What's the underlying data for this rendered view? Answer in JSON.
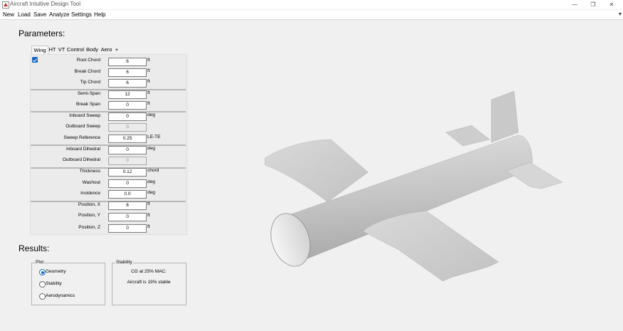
{
  "window": {
    "title": "Aircraft Intuitive Design Tool"
  },
  "menu": [
    "New",
    "Load",
    "Save",
    "Analyze",
    "Settings",
    "Help"
  ],
  "parameters": {
    "heading": "Parameters:",
    "tabs": [
      "Wing",
      "HT",
      "VT",
      "Control",
      "Body",
      "Aero",
      "+"
    ],
    "active_tab": "Wing",
    "checkbox_checked": true,
    "rows": [
      {
        "label": "Root Chord",
        "value": "6",
        "unit": "ft",
        "disabled": false
      },
      {
        "label": "Break Chord",
        "value": "6",
        "unit": "ft",
        "disabled": false
      },
      {
        "label": "Tip Chord",
        "value": "6",
        "unit": "ft",
        "disabled": false
      },
      {
        "label": "Semi-Span",
        "value": "12",
        "unit": "ft",
        "disabled": false
      },
      {
        "label": "Break Span",
        "value": "0",
        "unit": "ft",
        "disabled": false
      },
      {
        "label": "Inboard Sweep",
        "value": "0",
        "unit": "deg",
        "disabled": false
      },
      {
        "label": "Outboard Sweep",
        "value": "0",
        "unit": "",
        "disabled": true
      },
      {
        "label": "Sweep Reference",
        "value": "0.25",
        "unit": "LE-TE",
        "disabled": false
      },
      {
        "label": "Inboard Dihedral",
        "value": "0",
        "unit": "deg",
        "disabled": false
      },
      {
        "label": "Outboard Dihedral",
        "value": "0",
        "unit": "",
        "disabled": true
      },
      {
        "label": "Thickness",
        "value": "0.12",
        "unit": "chord",
        "disabled": false
      },
      {
        "label": "Washout",
        "value": "0",
        "unit": "deg",
        "disabled": false
      },
      {
        "label": "Incidence",
        "value": "0.0",
        "unit": "deg",
        "disabled": false
      },
      {
        "label": "Position, X",
        "value": "6",
        "unit": "ft",
        "disabled": false
      },
      {
        "label": "Position, Y",
        "value": "0",
        "unit": "ft",
        "disabled": false
      },
      {
        "label": "Position, Z",
        "value": "0",
        "unit": "ft",
        "disabled": false
      }
    ]
  },
  "results": {
    "heading": "Results:",
    "plot": {
      "legend": "Plot",
      "options": [
        "Geometry",
        "Stability",
        "Aerodynamics"
      ],
      "selected": "Geometry"
    },
    "stability": {
      "legend": "Stability",
      "cg_text": "CG at 25% MAC:",
      "status_text": "Aircraft is 19% stable"
    }
  },
  "colors": {
    "accent": "#1565c0",
    "background": "#f0f0f0",
    "model_surface": "#cfcfcf"
  }
}
